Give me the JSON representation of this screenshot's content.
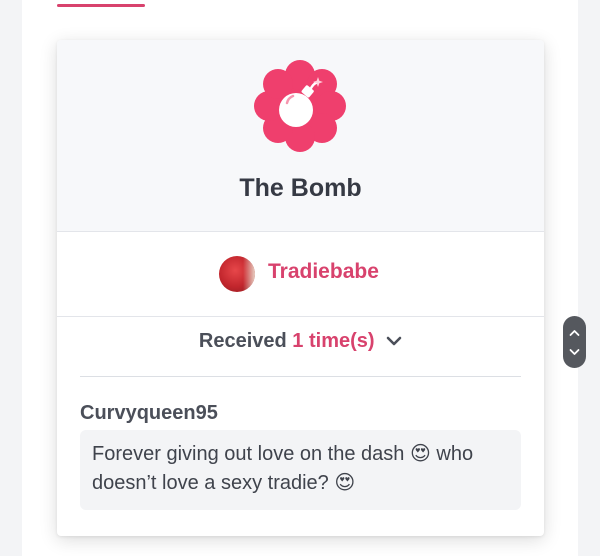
{
  "badge": {
    "title": "The Bomb",
    "icon": "bomb-icon",
    "badge_color": "#ef3f6d"
  },
  "sender": {
    "name": "Tradiebabe"
  },
  "received": {
    "prefix": "Received",
    "count_text": "1 time(s)"
  },
  "comment": {
    "author": "Curvyqueen95",
    "text": "Forever giving out love on the dash 😍 who doesn’t love a sexy tradie? 😍"
  },
  "colors": {
    "accent": "#d8426d",
    "text_dark": "#363a44"
  }
}
